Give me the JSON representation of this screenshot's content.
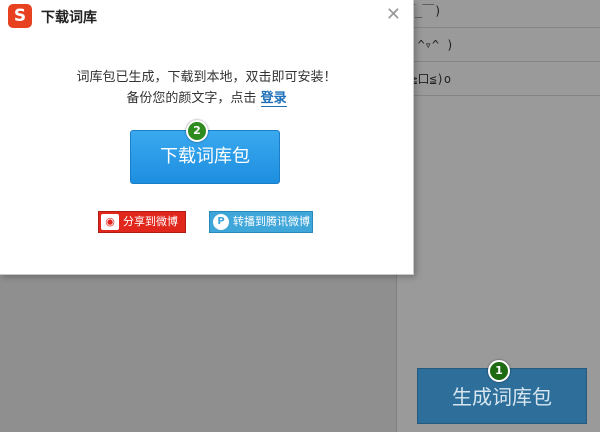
{
  "dialog": {
    "title": "下载词库",
    "logo_letter": "S",
    "close_symbol": "✕",
    "message_line1": "词库包已生成，下载到本地，双击即可安装！",
    "message_line2_prefix": "备份您的颜文字，点击 ",
    "login_link": "登录",
    "download_button": "下载词库包",
    "download_badge": "2",
    "share_weibo": "分享到微博",
    "share_tencent": "转播到腾讯微博"
  },
  "background": {
    "emoticons": [
      "￣_￣)",
      ". ^▿^ )",
      "(≧口≦)o"
    ],
    "generate_button": "生成词库包",
    "generate_badge": "1"
  },
  "colors": {
    "download_button": "#2b9be8",
    "badge_green": "#2f8a1f",
    "logo_red": "#e8411f",
    "weibo_red": "#e1261c",
    "tencent_blue": "#3fa6d9"
  }
}
